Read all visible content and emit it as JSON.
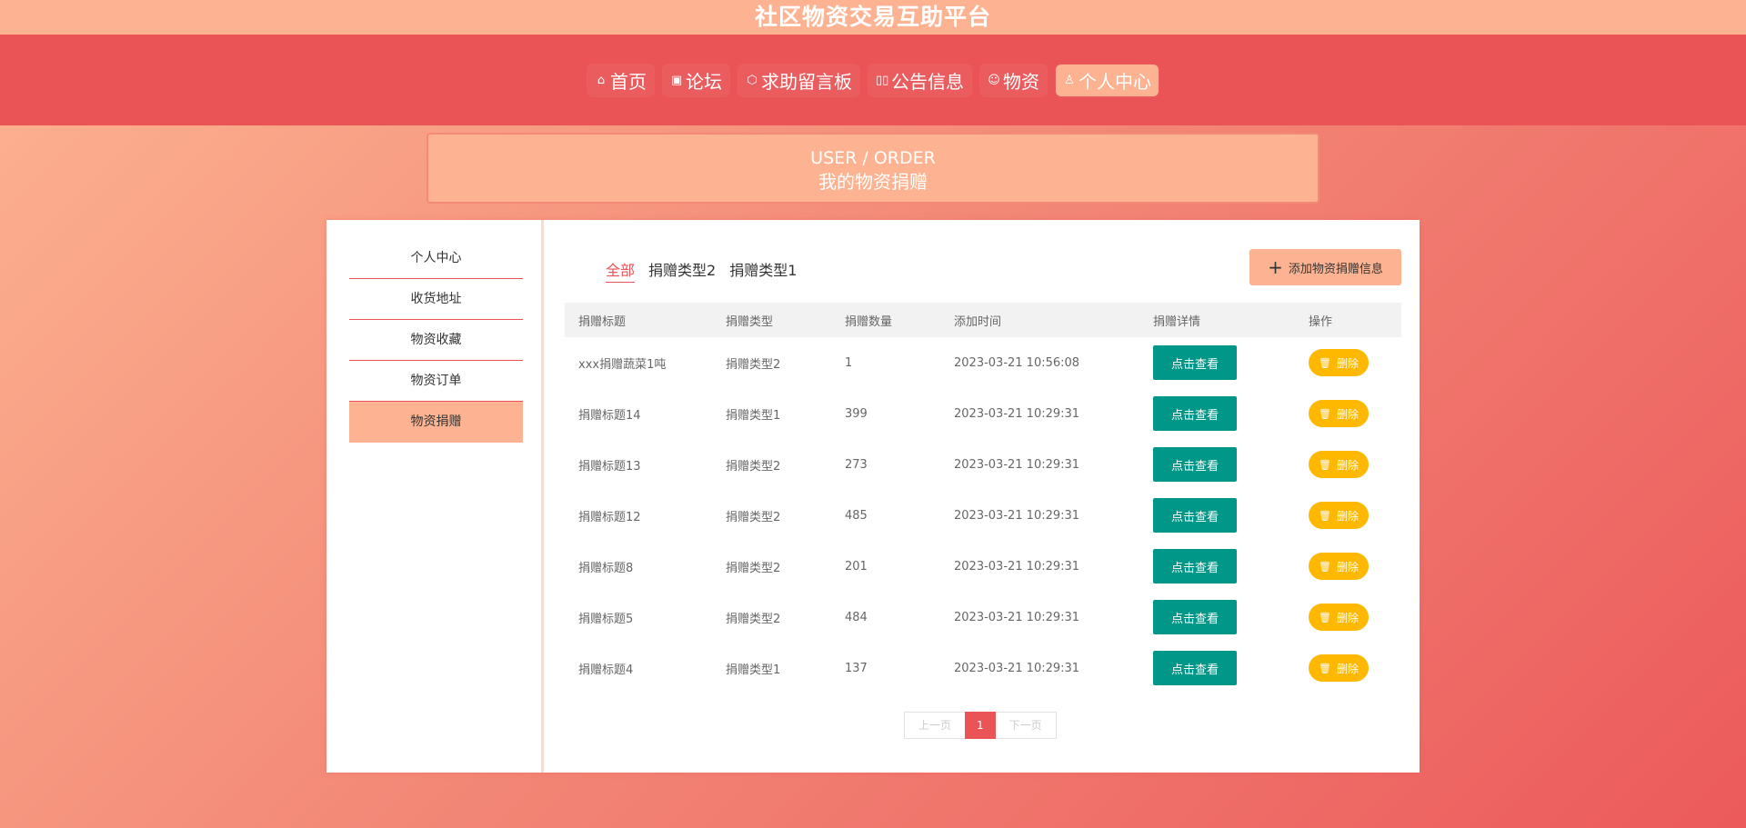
{
  "site": {
    "title": "社区物资交易互助平台"
  },
  "nav": {
    "items": [
      {
        "icon": "⌂",
        "label": "首页"
      },
      {
        "icon": "▣",
        "label": "论坛"
      },
      {
        "icon": "⬡",
        "label": "求助留言板"
      },
      {
        "icon": "▯▯",
        "label": "公告信息"
      },
      {
        "icon": "☺",
        "label": "物资"
      },
      {
        "icon": "♙",
        "label": "个人中心"
      }
    ]
  },
  "banner": {
    "en": "USER / ORDER",
    "cn": "我的物资捐赠"
  },
  "sidebar": {
    "items": [
      {
        "label": "个人中心"
      },
      {
        "label": "收货地址"
      },
      {
        "label": "物资收藏"
      },
      {
        "label": "物资订单"
      },
      {
        "label": "物资捐赠"
      }
    ]
  },
  "tabs": [
    {
      "label": "全部"
    },
    {
      "label": "捐赠类型2"
    },
    {
      "label": "捐赠类型1"
    }
  ],
  "actions": {
    "add_label": "添加物资捐赠信息",
    "plus": "+"
  },
  "table": {
    "headers": [
      "捐赠标题",
      "捐赠类型",
      "捐赠数量",
      "添加时间",
      "捐赠详情",
      "操作"
    ],
    "view_label": "点击查看",
    "delete_label": "删除",
    "trash": "🗑",
    "rows": [
      {
        "title": "xxx捐赠蔬菜1吨",
        "type": "捐赠类型2",
        "qty": "1",
        "time": "2023-03-21 10:56:08"
      },
      {
        "title": "捐赠标题14",
        "type": "捐赠类型1",
        "qty": "399",
        "time": "2023-03-21 10:29:31"
      },
      {
        "title": "捐赠标题13",
        "type": "捐赠类型2",
        "qty": "273",
        "time": "2023-03-21 10:29:31"
      },
      {
        "title": "捐赠标题12",
        "type": "捐赠类型2",
        "qty": "485",
        "time": "2023-03-21 10:29:31"
      },
      {
        "title": "捐赠标题8",
        "type": "捐赠类型2",
        "qty": "201",
        "time": "2023-03-21 10:29:31"
      },
      {
        "title": "捐赠标题5",
        "type": "捐赠类型2",
        "qty": "484",
        "time": "2023-03-21 10:29:31"
      },
      {
        "title": "捐赠标题4",
        "type": "捐赠类型1",
        "qty": "137",
        "time": "2023-03-21 10:29:31"
      }
    ]
  },
  "pagination": {
    "prev": "上一页",
    "current": "1",
    "next": "下一页"
  }
}
